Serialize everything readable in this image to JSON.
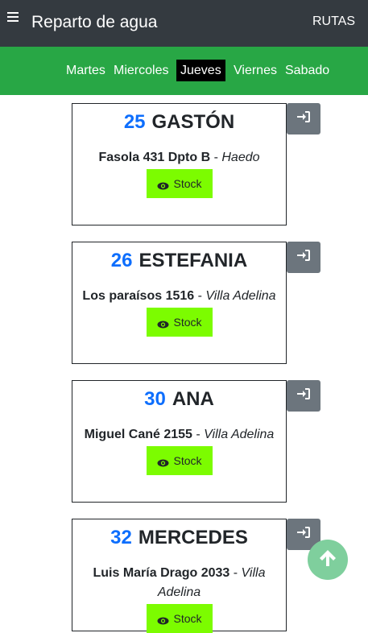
{
  "header": {
    "menu_icon": "hamburger-icon",
    "title": "Reparto de agua",
    "routes_label": "RUTAS"
  },
  "days": [
    {
      "label": "Martes"
    },
    {
      "label": "Miercoles"
    },
    {
      "label": "Jueves",
      "active": true
    },
    {
      "label": "Viernes"
    },
    {
      "label": "Sabado"
    }
  ],
  "cards": [
    {
      "number": "25",
      "name": "GASTÓN",
      "street": "Fasola 431 Dpto B",
      "separator": " - ",
      "locality": "Haedo",
      "stock_label": "Stock"
    },
    {
      "number": "26",
      "name": "ESTEFANIA",
      "street": "Los paraísos 1516",
      "separator": " - ",
      "locality": "Villa Adelina",
      "stock_label": "Stock"
    },
    {
      "number": "30",
      "name": "ANA",
      "street": "Miguel Cané 2155",
      "separator": " - ",
      "locality": "Villa Adelina",
      "stock_label": "Stock"
    },
    {
      "number": "32",
      "name": "MERCEDES",
      "street": "Luis María Drago 2033",
      "separator": " - ",
      "locality": "Villa Adelina",
      "stock_label": "Stock"
    }
  ],
  "colors": {
    "header_bg": "#343a40",
    "daybar_bg": "#28a745",
    "number": "#0d6efd",
    "stock_bg": "#7cfc00",
    "login_bg": "#6c757d",
    "fab_bg": "#7fcf9d"
  },
  "icons": {
    "stock": "eye-icon",
    "login": "sign-in-icon",
    "scroll_top": "arrow-up-icon"
  }
}
